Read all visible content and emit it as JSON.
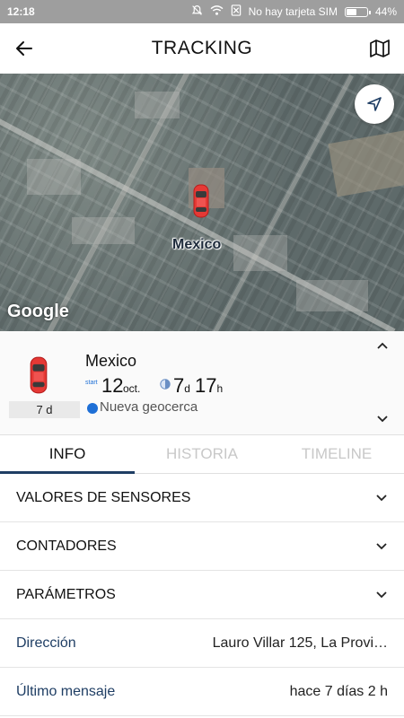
{
  "status_bar": {
    "time": "12:18",
    "sim_text": "No hay tarjeta SIM",
    "battery": "44%",
    "battery_level": 0.44
  },
  "header": {
    "title": "TRACKING",
    "back_icon": "arrow-left-icon",
    "map_icon": "map-icon"
  },
  "map": {
    "label": "Mexico",
    "provider": "Google",
    "locate_icon": "navigation-arrow-icon",
    "marker_color": "#e53935"
  },
  "card": {
    "name": "Mexico",
    "age": "7 d",
    "start_label": "start",
    "start_day": "12",
    "start_month": "oct.",
    "duration_days": "7",
    "duration_days_unit": "d",
    "duration_hours": "17",
    "duration_hours_unit": "h",
    "geofence": "Nueva geocerca",
    "geofence_color": "#1e6fd6"
  },
  "tabs": [
    {
      "label": "INFO",
      "active": true
    },
    {
      "label": "HISTORIA",
      "active": false
    },
    {
      "label": "TIMELINE",
      "active": false
    }
  ],
  "sections": [
    {
      "label": "VALORES DE SENSORES"
    },
    {
      "label": "CONTADORES"
    },
    {
      "label": "PARÁMETROS"
    }
  ],
  "details": [
    {
      "key": "Dirección",
      "value": "Lauro Villar 125, La Provi…"
    },
    {
      "key": "Último mensaje",
      "value": "hace 7 días 2 h"
    }
  ],
  "colors": {
    "accent": "#1f3e64",
    "status_bar": "#9e9e9e"
  }
}
